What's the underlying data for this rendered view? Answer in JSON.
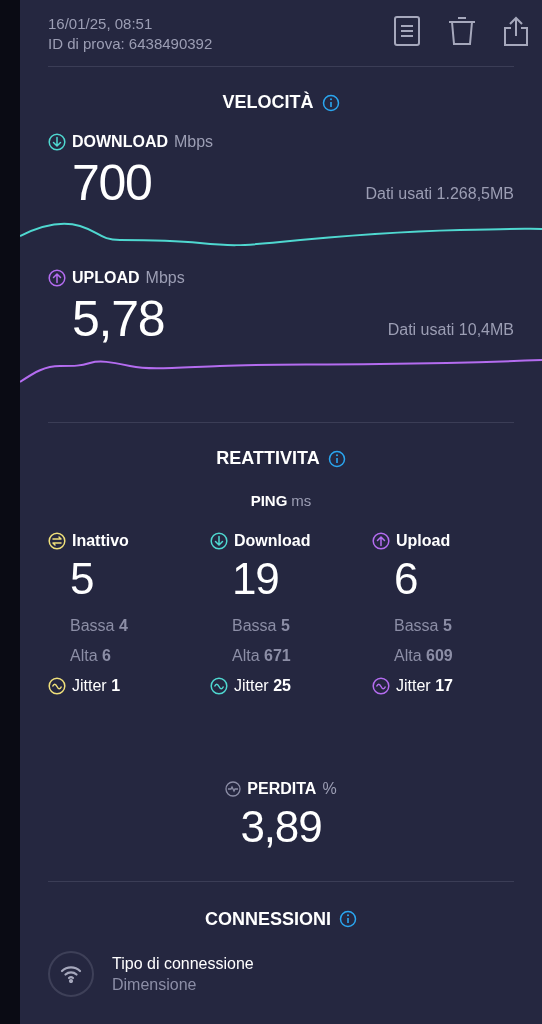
{
  "header": {
    "date": "16/01/25, 08:51",
    "test_id": "ID di prova: 6438490392"
  },
  "speed": {
    "title": "VELOCITÀ",
    "tests": [
      {
        "kind": "download",
        "label": "DOWNLOAD",
        "unit": "Mbps",
        "value": "700",
        "data_used": "Dati usati 1.268,5MB",
        "color": "#4fd8d0"
      },
      {
        "kind": "upload",
        "label": "UPLOAD",
        "unit": "Mbps",
        "value": "5,78",
        "data_used": "Dati usati 10,4MB",
        "color": "#b46cf0"
      }
    ]
  },
  "responsiveness": {
    "title": "REATTIVITA",
    "ping_label": "PING",
    "ping_unit": "ms",
    "columns": [
      {
        "kind": "idle",
        "label": "Inattivo",
        "value": "5",
        "low_label": "Bassa",
        "low": "4",
        "high_label": "Alta",
        "high": "6",
        "jitter_label": "Jitter",
        "jitter": "1",
        "color": "#f0e07a"
      },
      {
        "kind": "download",
        "label": "Download",
        "value": "19",
        "low_label": "Bassa",
        "low": "5",
        "high_label": "Alta",
        "high": "671",
        "jitter_label": "Jitter",
        "jitter": "25",
        "color": "#4fd8d0"
      },
      {
        "kind": "upload",
        "label": "Upload",
        "value": "6",
        "low_label": "Bassa",
        "low": "5",
        "high_label": "Alta",
        "high": "609",
        "jitter_label": "Jitter",
        "jitter": "17",
        "color": "#b46cf0"
      }
    ],
    "loss": {
      "label": "PERDITA",
      "unit": "%",
      "value": "3,89"
    }
  },
  "connections": {
    "title": "CONNESSIONI",
    "rows": [
      {
        "title": "Tipo di connessione",
        "subtitle": "Dimensione"
      }
    ]
  }
}
